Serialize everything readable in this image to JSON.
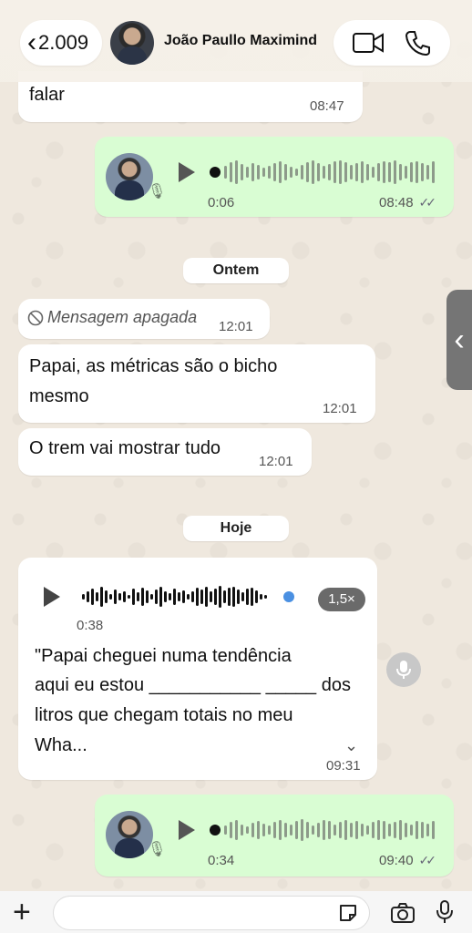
{
  "header": {
    "back_count": "2.009",
    "contact_name": "João Paullo Maximind"
  },
  "messages": {
    "m1_text": "falar",
    "m1_time": "08:47",
    "voice1_duration": "0:06",
    "voice1_time": "08:48",
    "chip_yesterday": "Ontem",
    "deleted_text": "Mensagem apagada",
    "deleted_time": "12:01",
    "m2_line1": "Papai, as métricas são o bicho",
    "m2_line2": "mesmo",
    "m2_time": "12:01",
    "m3_text": "O trem vai mostrar tudo",
    "m3_time": "12:01",
    "chip_today": "Hoje",
    "audio_duration": "0:38",
    "audio_speed": "1,5×",
    "transcript_line1": "\"Papai cheguei numa tendência",
    "transcript_line2": "aqui eu estou ___________ _____ dos",
    "transcript_line3": "litros que chegam totais no meu",
    "transcript_line4": "Wha...",
    "audio_time": "09:31",
    "voice2_duration": "0:34",
    "voice2_time": "09:40"
  },
  "icons": {
    "back": "chevron-left-icon",
    "video": "video-camera-icon",
    "phone": "phone-icon",
    "deleted": "block-icon",
    "mic": "microphone-icon",
    "camera": "camera-icon",
    "sticker": "sticker-icon",
    "plus": "plus-icon"
  },
  "colors": {
    "outgoing_bubble": "#d9fdd3",
    "incoming_bubble": "#ffffff",
    "audio_progress": "#4a90e2"
  }
}
